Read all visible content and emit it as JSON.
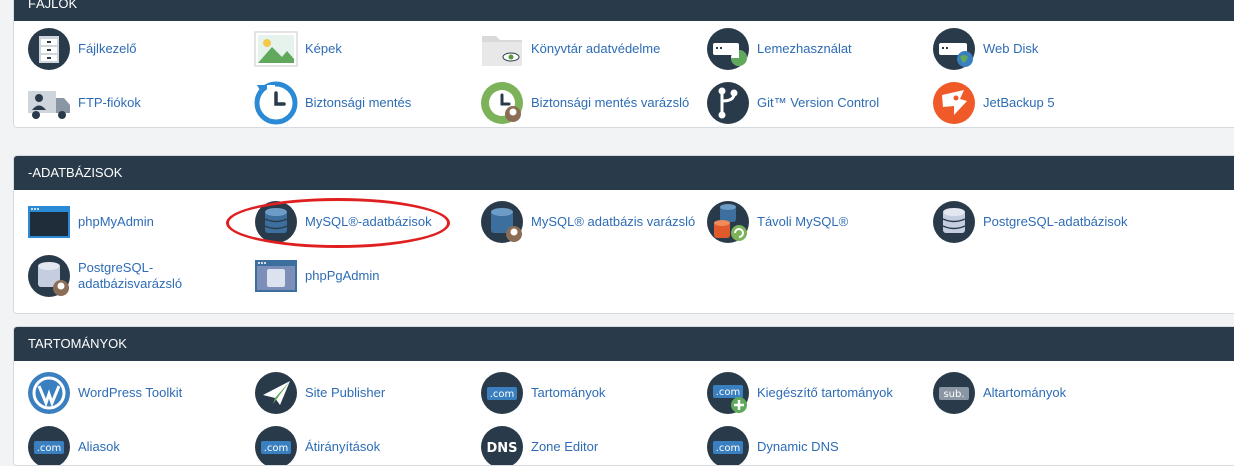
{
  "files": {
    "title": "FÁJLOK",
    "items": [
      {
        "label": "Fájlkezelő"
      },
      {
        "label": "Képek"
      },
      {
        "label": "Könyvtár adatvédelme"
      },
      {
        "label": "Lemezhasználat"
      },
      {
        "label": "Web Disk"
      },
      {
        "label": "FTP-fiókok"
      },
      {
        "label": "Biztonsági mentés"
      },
      {
        "label": "Biztonsági mentés varázsló"
      },
      {
        "label": "Git™ Version Control"
      },
      {
        "label": "JetBackup 5"
      }
    ]
  },
  "databases": {
    "title": "-ADATBÁZISOK",
    "items": [
      {
        "label": "phpMyAdmin"
      },
      {
        "label": "MySQL®-adatbázisok"
      },
      {
        "label": "MySQL® adatbázis varázsló"
      },
      {
        "label": "Távoli MySQL®"
      },
      {
        "label": "PostgreSQL-adatbázisok"
      },
      {
        "label": "PostgreSQL-adatbázisvarázsló"
      },
      {
        "label": "phpPgAdmin"
      }
    ]
  },
  "domains": {
    "title": "TARTOMÁNYOK",
    "items": [
      {
        "label": "WordPress Toolkit"
      },
      {
        "label": "Site Publisher"
      },
      {
        "label": "Tartományok"
      },
      {
        "label": "Kiegészítő tartományok"
      },
      {
        "label": "Altartományok"
      },
      {
        "label": "Aliasok"
      },
      {
        "label": "Átirányítások"
      },
      {
        "label": "Zone Editor"
      },
      {
        "label": "Dynamic DNS"
      }
    ],
    "icon_texts": {
      "com": ".com",
      "sub": "sub.",
      "dns": "DNS"
    }
  },
  "colors": {
    "header": "#293a4a",
    "link": "#2d6cb5",
    "dark_icon": "#293a4a",
    "annotation": "#e02020"
  }
}
